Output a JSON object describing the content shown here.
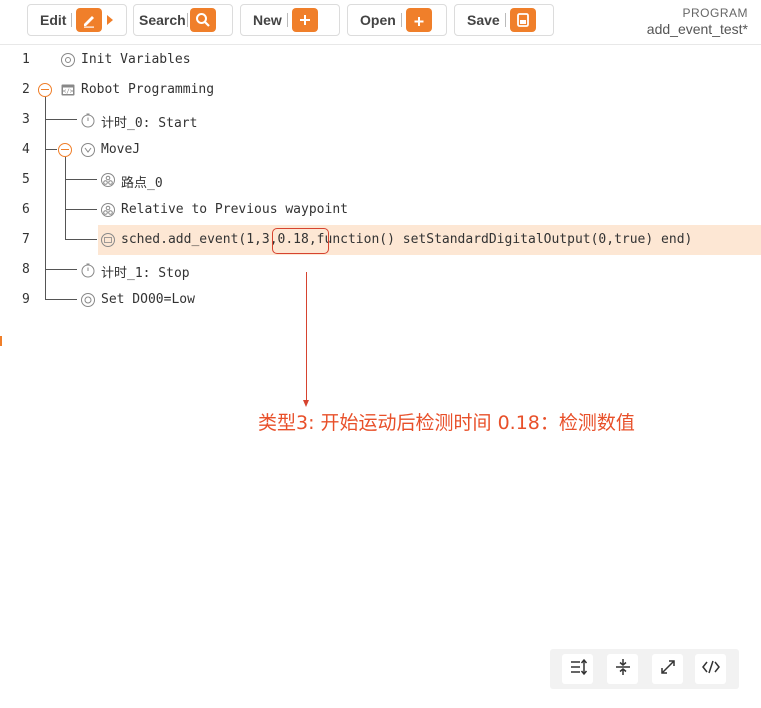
{
  "toolbar": {
    "edit_label": "Edit",
    "search_label": "Search",
    "new_label": "New",
    "open_label": "Open",
    "save_label": "Save"
  },
  "program": {
    "label": "PROGRAM",
    "name": "add_event_test*"
  },
  "tree_rows": [
    {
      "num": "1",
      "text": "Init Variables",
      "icon": "init-variables-icon"
    },
    {
      "num": "2",
      "text": "Robot Programming",
      "icon": "robot-program-icon"
    },
    {
      "num": "3",
      "text": "计时_0: Start",
      "icon": "timer-icon"
    },
    {
      "num": "4",
      "text": "MoveJ",
      "icon": "movej-icon"
    },
    {
      "num": "5",
      "text": "路点_0",
      "icon": "waypoint-icon"
    },
    {
      "num": "6",
      "text": "Relative to Previous waypoint",
      "icon": "waypoint-icon"
    },
    {
      "num": "7",
      "text": "sched.add_event(1,3,0.18,function() setStandardDigitalOutput(0,true) end)",
      "icon": "script-icon"
    },
    {
      "num": "8",
      "text": "计时_1: Stop",
      "icon": "timer-icon"
    },
    {
      "num": "9",
      "text": "Set DO00=Low",
      "icon": "set-icon"
    }
  ],
  "annotation": {
    "text": "类型3: 开始运动后检测时间   0.18：检测数值"
  },
  "bottom_toolbar": [
    {
      "icon": "sort-icon"
    },
    {
      "icon": "collapse-all-icon"
    },
    {
      "icon": "expand-icon"
    },
    {
      "icon": "code-icon"
    }
  ],
  "colors": {
    "accent": "#f07f2a",
    "highlight_row": "#fde7d4",
    "annotation_red": "#d6432f"
  }
}
